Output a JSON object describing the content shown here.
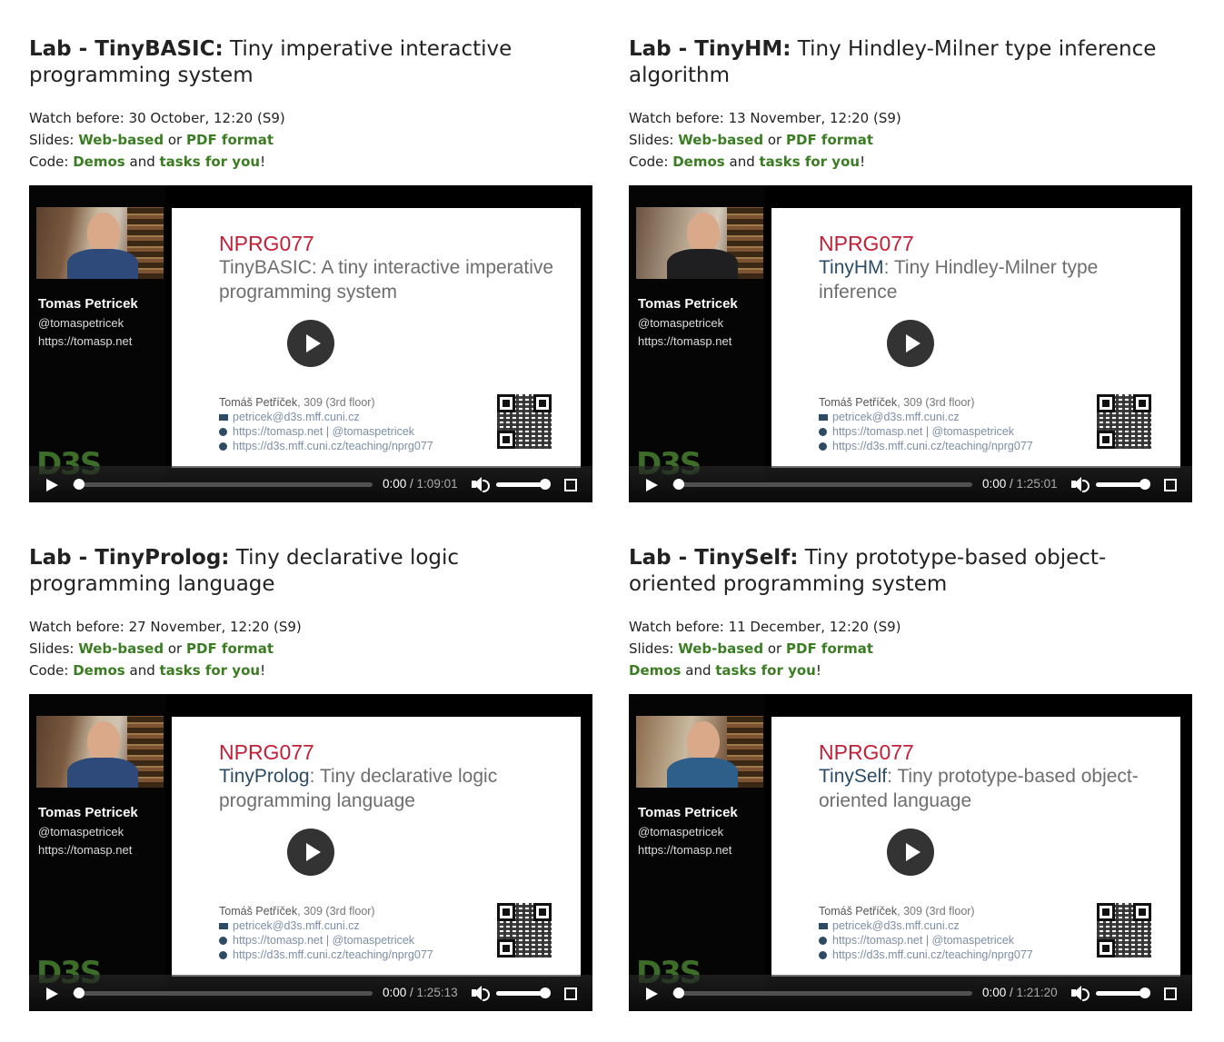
{
  "labs": [
    {
      "prefix": "Lab - ",
      "name": "TinyBASIC:",
      "subtitle": " Tiny imperative interactive programming system",
      "watch_label": "Watch before: ",
      "watch_date": "30 October, 12:20 (S9)",
      "slides_label": "Slides: ",
      "slides_web": "Web-based",
      "slides_or": " or ",
      "slides_pdf": "PDF format",
      "code_label": "Code: ",
      "code_demos": "Demos",
      "code_and": " and ",
      "code_tasks": "tasks for you",
      "code_end": "!",
      "video": {
        "presenter_name": "Tomas Petricek",
        "presenter_handle": "@tomaspetricek",
        "presenter_url": "https://tomasp.net",
        "logo": "D3S",
        "course": "NPRG077",
        "title_accent": "",
        "title_rest": "TinyBASIC: A tiny interactive imperative programming system",
        "author": "Tomáš Petříček",
        "room": ", 309 (3rd floor)",
        "email": "petricek@d3s.mff.cuni.cz",
        "web": "https://tomasp.net | @tomaspetricek",
        "course_url": "https://d3s.mff.cuni.cz/teaching/nprg077",
        "time_current": "0:00",
        "time_sep": " / ",
        "time_duration": "1:09:01"
      }
    },
    {
      "prefix": "Lab - ",
      "name": "TinyHM:",
      "subtitle": " Tiny Hindley-Milner type inference algorithm",
      "watch_label": "Watch before: ",
      "watch_date": "13 November, 12:20 (S9)",
      "slides_label": "Slides: ",
      "slides_web": "Web-based",
      "slides_or": " or ",
      "slides_pdf": "PDF format",
      "code_label": "Code: ",
      "code_demos": "Demos",
      "code_and": " and ",
      "code_tasks": "tasks for you",
      "code_end": "!",
      "video": {
        "presenter_name": "Tomas Petricek",
        "presenter_handle": "@tomaspetricek",
        "presenter_url": "https://tomasp.net",
        "logo": "D3S",
        "course": "NPRG077",
        "title_accent": "TinyHM",
        "title_rest": ": Tiny Hindley-Milner type inference",
        "author": "Tomáš Petříček",
        "room": ", 309 (3rd floor)",
        "email": "petricek@d3s.mff.cuni.cz",
        "web": "https://tomasp.net | @tomaspetricek",
        "course_url": "https://d3s.mff.cuni.cz/teaching/nprg077",
        "time_current": "0:00",
        "time_sep": " / ",
        "time_duration": "1:25:01"
      }
    },
    {
      "prefix": "Lab - ",
      "name": "TinyProlog:",
      "subtitle": " Tiny declarative logic programming language",
      "watch_label": "Watch before: ",
      "watch_date": "27 November, 12:20 (S9)",
      "slides_label": "Slides: ",
      "slides_web": "Web-based",
      "slides_or": " or ",
      "slides_pdf": "PDF format",
      "code_label": "Code: ",
      "code_demos": "Demos",
      "code_and": " and ",
      "code_tasks": "tasks for you",
      "code_end": "!",
      "video": {
        "presenter_name": "Tomas Petricek",
        "presenter_handle": "@tomaspetricek",
        "presenter_url": "https://tomasp.net",
        "logo": "D3S",
        "course": "NPRG077",
        "title_accent": "TinyProlog",
        "title_rest": ": Tiny declarative logic programming language",
        "author": "Tomáš Petříček",
        "room": ", 309 (3rd floor)",
        "email": "petricek@d3s.mff.cuni.cz",
        "web": "https://tomasp.net | @tomaspetricek",
        "course_url": "https://d3s.mff.cuni.cz/teaching/nprg077",
        "time_current": "0:00",
        "time_sep": " / ",
        "time_duration": "1:25:13"
      }
    },
    {
      "prefix": "Lab - ",
      "name": "TinySelf:",
      "subtitle": " Tiny prototype-based object-oriented programming system",
      "watch_label": "Watch before: ",
      "watch_date": "11 December, 12:20 (S9)",
      "slides_label": "Slides: ",
      "slides_web": "Web-based",
      "slides_or": " or ",
      "slides_pdf": "PDF format",
      "code_label": "",
      "code_demos": "Demos",
      "code_and": " and ",
      "code_tasks": "tasks for you",
      "code_end": "!",
      "video": {
        "presenter_name": "Tomas Petricek",
        "presenter_handle": "@tomaspetricek",
        "presenter_url": "https://tomasp.net",
        "logo": "D3S",
        "course": "NPRG077",
        "title_accent": "TinySelf",
        "title_rest": ": Tiny prototype-based object-oriented language",
        "author": "Tomáš Petříček",
        "room": ", 309 (3rd floor)",
        "email": "petricek@d3s.mff.cuni.cz",
        "web": "https://tomasp.net | @tomaspetricek",
        "course_url": "https://d3s.mff.cuni.cz/teaching/nprg077",
        "time_current": "0:00",
        "time_sep": " / ",
        "time_duration": "1:21:20"
      }
    }
  ],
  "colors": {
    "link": "#3b7d23",
    "course_code": "#c32037",
    "slide_accent": "#2c4b64"
  },
  "icons": {
    "play": "play-icon",
    "volume": "volume-icon",
    "fullscreen": "fullscreen-icon",
    "email": "envelope-icon",
    "bullet": "circle-arrow-icon",
    "qr": "qr-code"
  }
}
